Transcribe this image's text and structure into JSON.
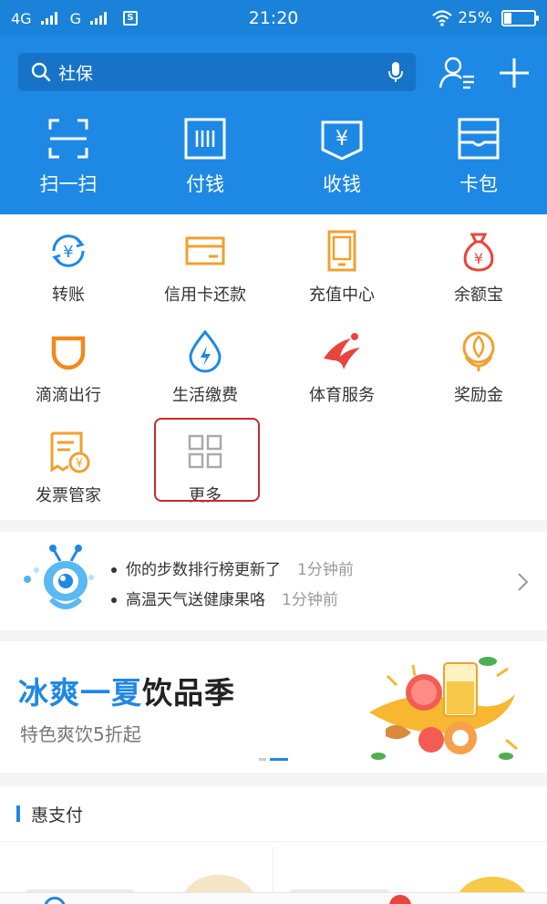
{
  "status_bar": {
    "network1": "4G",
    "network2": "G",
    "sim_icon": "S",
    "time": "21:20",
    "battery": "25%",
    "battery_level": 0.25
  },
  "header": {
    "search_placeholder": "社保",
    "top_actions": [
      {
        "label": "扫一扫",
        "icon": "scan-icon"
      },
      {
        "label": "付钱",
        "icon": "barcode-icon"
      },
      {
        "label": "收钱",
        "icon": "yuan-receipt-icon"
      },
      {
        "label": "卡包",
        "icon": "card-wallet-icon"
      }
    ]
  },
  "grid": {
    "items": [
      {
        "label": "转账",
        "icon": "transfer-icon"
      },
      {
        "label": "信用卡还款",
        "icon": "credit-card-icon"
      },
      {
        "label": "充值中心",
        "icon": "phone-recharge-icon"
      },
      {
        "label": "余额宝",
        "icon": "money-bag-icon"
      },
      {
        "label": "滴滴出行",
        "icon": "didi-icon"
      },
      {
        "label": "生活缴费",
        "icon": "water-drop-icon"
      },
      {
        "label": "体育服务",
        "icon": "sports-icon"
      },
      {
        "label": "奖励金",
        "icon": "reward-icon"
      },
      {
        "label": "发票管家",
        "icon": "invoice-icon"
      },
      {
        "label": "更多",
        "icon": "more-grid-icon"
      }
    ]
  },
  "notification": {
    "lines": [
      {
        "text": "你的步数排行榜更新了",
        "time": "1分钟前"
      },
      {
        "text": "高温天气送健康果咯",
        "time": "1分钟前"
      }
    ]
  },
  "banner": {
    "title_blue": "冰爽一夏",
    "title_dark": "饮品季",
    "subtitle": "特色爽饮5折起"
  },
  "section": {
    "title": "惠支付"
  },
  "colors": {
    "brand_blue": "#1e88e5",
    "orange": "#f0a030",
    "red": "#e8453c",
    "highlight_red": "#c8282f"
  }
}
